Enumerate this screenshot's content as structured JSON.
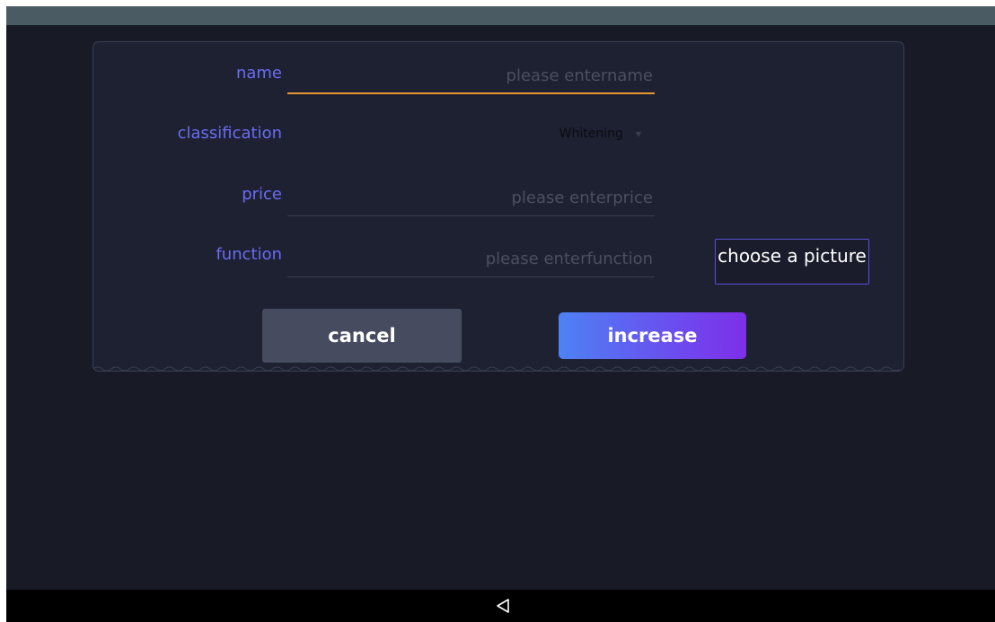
{
  "form": {
    "name": {
      "label": "name",
      "value": "",
      "placeholder": "please entername"
    },
    "classification": {
      "label": "classification",
      "selected": "Whitening"
    },
    "price": {
      "label": "price",
      "value": "",
      "placeholder": "please enterprice"
    },
    "function": {
      "label": "function",
      "value": "",
      "placeholder": "please enterfunction"
    },
    "choose_picture_label": "choose a picture"
  },
  "actions": {
    "cancel_label": "cancel",
    "increase_label": "increase"
  },
  "icons": {
    "select_caret": "caret-down-icon",
    "nav_back": "back-triangle-icon"
  },
  "colors": {
    "background": "#181b26",
    "dialog": "#1e2131",
    "label": "#6a6cf4",
    "focus_underline": "#e8962e",
    "primary_gradient_start": "#4d82f4",
    "primary_gradient_end": "#7e2fe8",
    "cancel_bg": "#474b5f"
  }
}
